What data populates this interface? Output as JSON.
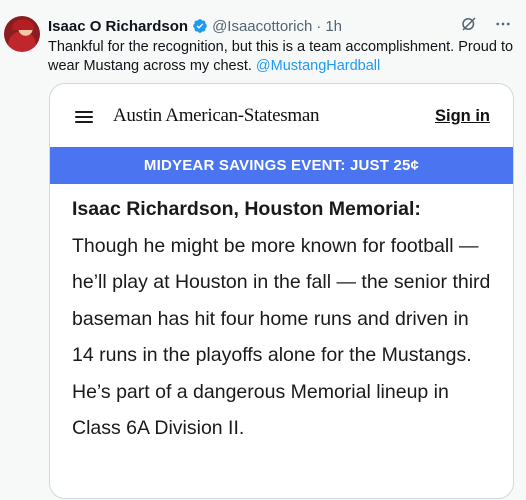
{
  "tweet": {
    "author_name": "Isaac O Richardson",
    "handle": "@Isaacottorich",
    "separator": "·",
    "time": "1h",
    "text_before_mention": "Thankful for the recognition, but this is a team accomplishment. Proud to wear Mustang across my chest. ",
    "mention": "@MustangHardball",
    "icons": [
      "verified-badge-icon",
      "grok-icon",
      "more-icon"
    ]
  },
  "card": {
    "masthead": "Austin American-Statesman",
    "sign_in_label": "Sign in",
    "promo_banner": "MIDYEAR SAVINGS EVENT: JUST 25¢",
    "article_lead": "Isaac Richardson, Houston Memorial:",
    "article_body": "Though he might be more known for football — he’ll play at Houston in the fall — the senior third baseman has hit four home runs and driven in 14 runs in the playoffs alone for the Mustangs. He’s part of a dangerous Memorial lineup in Class 6A Division II."
  },
  "colors": {
    "accent": "#1d9bf0",
    "promo_banner_bg": "#4a74f0",
    "text_secondary": "#536471"
  }
}
